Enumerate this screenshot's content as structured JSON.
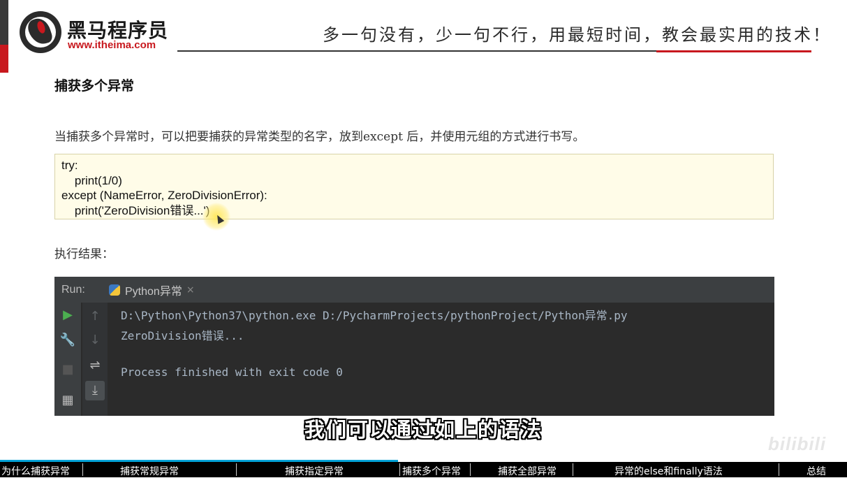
{
  "header": {
    "brand_name": "黑马程序员",
    "brand_url": "www.itheima.com",
    "slogan": "多一句没有，少一句不行，用最短时间，教会最实用的技术！"
  },
  "content": {
    "section_title": "捕获多个异常",
    "description": "当捕获多个异常时，可以把要捕获的异常类型的名字，放到except 后，并使用元组的方式进行书写。",
    "code_lines": [
      "try:",
      "    print(1/0)",
      "except (NameError, ZeroDivisionError):",
      "    print('ZeroDivision错误...')"
    ],
    "result_label": "执行结果："
  },
  "run_panel": {
    "label": "Run:",
    "tab_label": "Python异常",
    "tab_close": "×",
    "console_lines": [
      "D:\\Python\\Python37\\python.exe D:/PycharmProjects/pythonProject/Python异常.py",
      "ZeroDivision错误...",
      "",
      "Process finished with exit code 0"
    ],
    "tool_icons": [
      "run-icon",
      "wrench-icon",
      "stop-icon",
      "layout-icon",
      "arrow-up-icon",
      "arrow-down-icon",
      "soft-wrap-icon",
      "scroll-to-end-icon"
    ]
  },
  "subtitle": "我们可以通过如上的语法",
  "watermark": "bilibili",
  "chapters": {
    "items": [
      "为什么捕获异常",
      "捕获常规异常",
      "捕获指定异常",
      "捕获多个异常",
      "捕获全部异常",
      "异常的else和finally语法",
      "总结"
    ],
    "active_index": 3,
    "progress_fraction": 0.47
  },
  "colors": {
    "brand_red": "#c8181e",
    "code_bg": "#fffce8",
    "console_bg": "#2b2b2b",
    "console_text": "#a9b7c6",
    "progress": "#00a1d6"
  }
}
